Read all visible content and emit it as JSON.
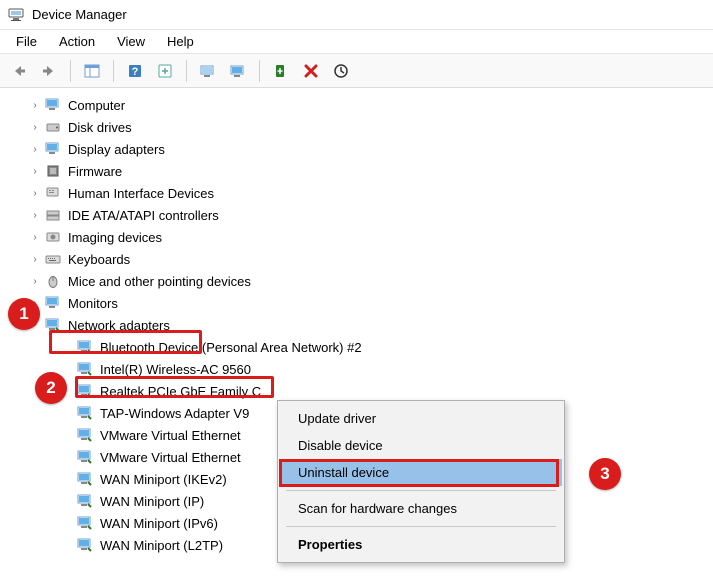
{
  "window": {
    "title": "Device Manager"
  },
  "menu": {
    "file": "File",
    "action": "Action",
    "view": "View",
    "help": "Help"
  },
  "tree": {
    "computer": "Computer",
    "disk_drives": "Disk drives",
    "display_adapters": "Display adapters",
    "firmware": "Firmware",
    "hid": "Human Interface Devices",
    "ide": "IDE ATA/ATAPI controllers",
    "imaging": "Imaging devices",
    "keyboards": "Keyboards",
    "mice": "Mice and other pointing devices",
    "monitors": "Monitors",
    "network_adapters": "Network adapters",
    "net": {
      "bt": "Bluetooth Device (Personal Area Network) #2",
      "intel": "Intel(R) Wireless-AC 9560",
      "realtek": "Realtek PCIe GbE Family C",
      "tap": "TAP-Windows Adapter V9",
      "vmnet1": "VMware Virtual Ethernet",
      "vmnet8": "VMware Virtual Ethernet",
      "wan_ikev2": "WAN Miniport (IKEv2)",
      "wan_ip": "WAN Miniport (IP)",
      "wan_ipv6": "WAN Miniport (IPv6)",
      "wan_l2tp": "WAN Miniport (L2TP)"
    }
  },
  "context_menu": {
    "update": "Update driver",
    "disable": "Disable device",
    "uninstall": "Uninstall device",
    "scan": "Scan for hardware changes",
    "properties": "Properties"
  },
  "annotations": {
    "n1": "1",
    "n2": "2",
    "n3": "3"
  }
}
